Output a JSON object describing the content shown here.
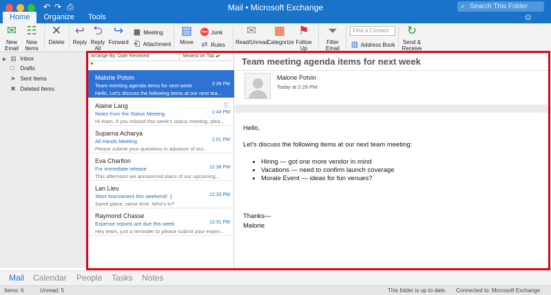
{
  "window": {
    "title": "Mail • Microsoft Exchange",
    "search_placeholder": "Search This Folder",
    "tabs": [
      "Home",
      "Organize",
      "Tools"
    ]
  },
  "ribbon": {
    "new_email": "New Email",
    "new_items": "New Items",
    "delete": "Delete",
    "reply": "Reply",
    "reply_all": "Reply All",
    "forward": "Forward",
    "meeting": "Meeting",
    "attachment": "Attachment",
    "move": "Move",
    "junk": "Junk",
    "rules": "Rules",
    "read_unread": "Read/Unread",
    "categorize": "Categorize",
    "follow_up": "Follow Up",
    "filter_email": "Filter Email",
    "find_contact_placeholder": "Find a Contact",
    "address_book": "Address Book",
    "send_receive": "Send & Receive"
  },
  "sidebar": {
    "folders": [
      "Inbox",
      "Drafts",
      "Sent Items",
      "Deleted Items"
    ]
  },
  "list": {
    "arrange_by": "Arrange By: Date Received",
    "sort": "Newest on Top",
    "messages": [
      {
        "from": "Malorie Potvin",
        "subject": "Team meeting agenda items for next week",
        "time": "2:28 PM",
        "preview": "Hello, Let's discuss the following items at our next tea..."
      },
      {
        "from": "Alaine Lang",
        "subject": "Notes from the Status Meeting",
        "time": "1:44 PM",
        "preview": "Hi team, if you missed this week's status meeting, plea..."
      },
      {
        "from": "Suparna Acharya",
        "subject": "All Hands Meeting",
        "time": "1:01 PM",
        "preview": "Please submit your questions in advance of our..."
      },
      {
        "from": "Eva Charlton",
        "subject": "For immediate release",
        "time": "12:38 PM",
        "preview": "This afternoon we announced plans of our upcoming..."
      },
      {
        "from": "Lan Lieu",
        "subject": "Xbox tournament this weekend! :)",
        "time": "12:33 PM",
        "preview": "Same place, same time. Who's in?"
      },
      {
        "from": "Raymond Chasse",
        "subject": "Expense reports are due this week",
        "time": "12:31 PM",
        "preview": "Hey team, just a reminder to please submit your expen..."
      }
    ]
  },
  "reading": {
    "subject": "Team meeting agenda items for next week",
    "sender": "Malorie Potvin",
    "date": "Today at 2:28 PM",
    "greeting": "Hello,",
    "intro": "Let's discuss the following items at our next team meeting:",
    "bullets": [
      "Hiring — got one more vendor in mind",
      "Vacations — need to confirm launch coverage",
      "Morale Event — ideas for fun venues?"
    ],
    "closing": "Thanks—",
    "signature": "Malorie"
  },
  "nav": [
    "Mail",
    "Calendar",
    "People",
    "Tasks",
    "Notes"
  ],
  "status": {
    "items": "Items: 6",
    "unread": "Unread: 5",
    "sync": "This folder is up to date.",
    "connection": "Connected to: Microsoft Exchange"
  },
  "colors": {
    "accent": "#1a73c9",
    "selection": "#2d72d2",
    "highlight_frame": "#e60012"
  }
}
